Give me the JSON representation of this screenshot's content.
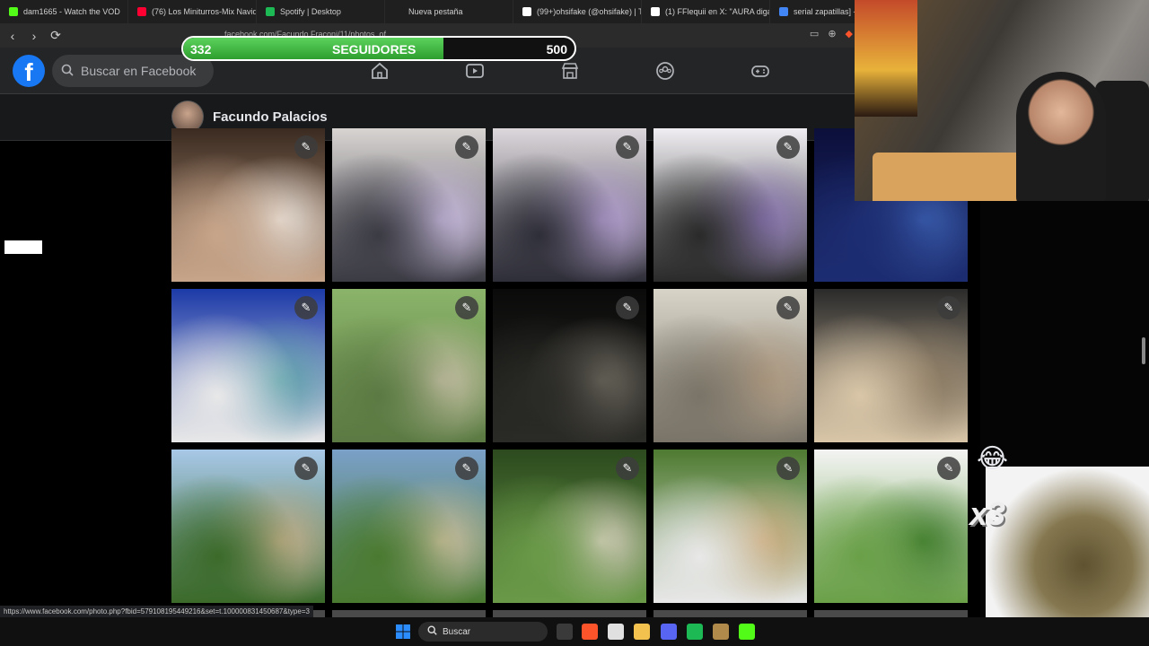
{
  "browser": {
    "tabs": [
      {
        "label": "dam1665 - Watch the VOD",
        "color": "#53fc18"
      },
      {
        "label": "(76) Los Miniturros-Mix Navide",
        "color": "#ff0033"
      },
      {
        "label": "Spotify | Desktop",
        "color": "#1db954"
      },
      {
        "label": "Nueva pestaña",
        "color": "#1f1f1f"
      },
      {
        "label": "(99+)ohsifake (@ohsifake) | Tik",
        "color": "#ffffff"
      },
      {
        "label": "(1) FFlequii en X: \"AURA digan",
        "color": "#ffffff"
      },
      {
        "label": "serial zapatillas] - Bu",
        "color": "#4285f4"
      }
    ],
    "url": "facebook.com/Facundo.Fraconi/11/photos_of",
    "status_url": "https://www.facebook.com/photo.php?fbid=579108195449216&set=t.100000831450687&type=3"
  },
  "followers_bar": {
    "current": "332",
    "label": "SEGUIDORES",
    "goal": "500",
    "progress": 0.664
  },
  "facebook": {
    "logo": "f",
    "search_placeholder": "Buscar en Facebook",
    "nav_icons": [
      "home-icon",
      "video-icon",
      "marketplace-icon",
      "groups-icon",
      "gaming-icon"
    ],
    "profile_name": "Facundo Palacios"
  },
  "photos": [
    {
      "desc": "party-group",
      "colors": [
        "#3a2a20",
        "#c7a58a",
        "#e8e0d8"
      ]
    },
    {
      "desc": "dance-couple",
      "colors": [
        "#d8d4d2",
        "#3b3b44",
        "#cfc0e6"
      ]
    },
    {
      "desc": "quince-dance",
      "colors": [
        "#ddd8dc",
        "#2e2e38",
        "#b9a3d8"
      ]
    },
    {
      "desc": "guests",
      "colors": [
        "#f0eef2",
        "#2a2a2a",
        "#8d78b8"
      ]
    },
    {
      "desc": "dark-party",
      "colors": [
        "#0c0f3a",
        "#1d2d72",
        "#3b5fb0"
      ]
    },
    {
      "desc": "bus-friends",
      "colors": [
        "#1c3aa8",
        "#e8e8e8",
        "#5aa0a8"
      ]
    },
    {
      "desc": "grass-sitting",
      "colors": [
        "#8bb46a",
        "#5b7a43",
        "#c9c0a8"
      ]
    },
    {
      "desc": "night-group",
      "colors": [
        "#0a0a0a",
        "#2a2a26",
        "#6e6a60"
      ]
    },
    {
      "desc": "scouts-house",
      "colors": [
        "#d8d4c8",
        "#7a7468",
        "#b09a80"
      ]
    },
    {
      "desc": "scouts-close",
      "colors": [
        "#2a2a2a",
        "#d9c6a8",
        "#8b7a62"
      ]
    },
    {
      "desc": "scouts-flags",
      "colors": [
        "#a8c8e8",
        "#3b6a2a",
        "#c8b08c"
      ]
    },
    {
      "desc": "scouts-trees",
      "colors": [
        "#7aa0c8",
        "#4a7a30",
        "#d0c0a0"
      ]
    },
    {
      "desc": "park-group",
      "colors": [
        "#2c4a1e",
        "#6a9a48",
        "#d8d0c0"
      ]
    },
    {
      "desc": "girls-pose",
      "colors": [
        "#4e7a30",
        "#e8e8e8",
        "#c8a878"
      ]
    },
    {
      "desc": "football-field",
      "colors": [
        "#f4f4f4",
        "#6aa048",
        "#3e7a2c"
      ]
    }
  ],
  "overlay": {
    "emoji": "😂",
    "multiplier": "x3"
  },
  "taskbar": {
    "search_label": "Buscar",
    "apps": [
      {
        "name": "windows-start-icon",
        "color": "#2b8cff"
      },
      {
        "name": "file-explorer-icon",
        "color": "#3a3a3a"
      },
      {
        "name": "brave-icon",
        "color": "#fb542b"
      },
      {
        "name": "chrome-icon",
        "color": "#e0e0e0"
      },
      {
        "name": "folder-icon",
        "color": "#f2c14e"
      },
      {
        "name": "discord-icon",
        "color": "#5865f2"
      },
      {
        "name": "spotify-icon",
        "color": "#1db954"
      },
      {
        "name": "app-icon",
        "color": "#b08a4a"
      },
      {
        "name": "kick-icon",
        "color": "#53fc18"
      }
    ]
  }
}
